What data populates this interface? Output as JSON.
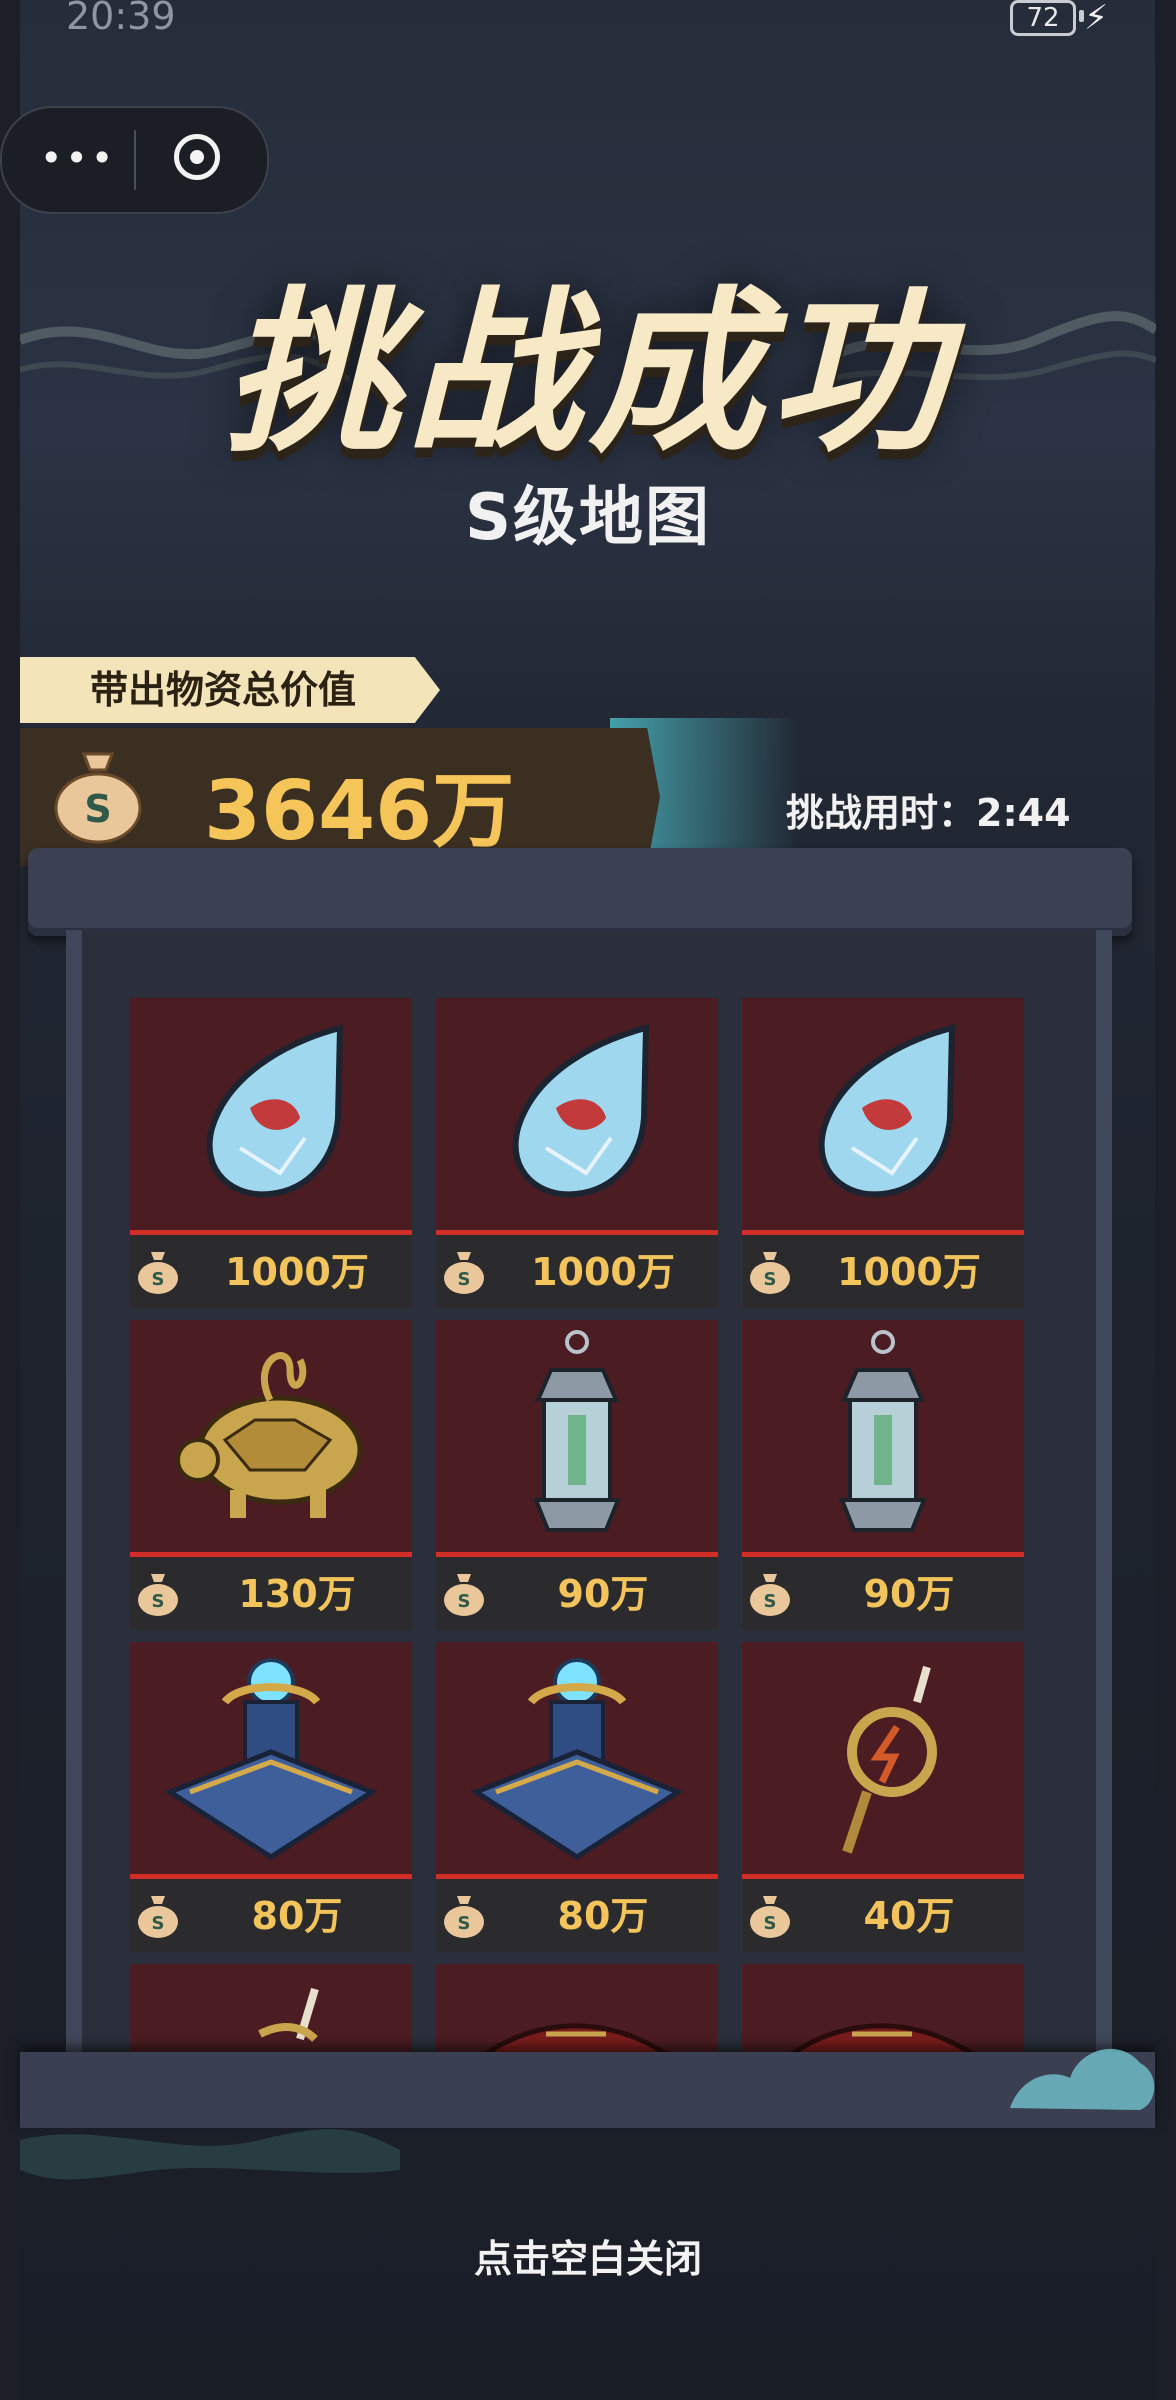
{
  "status_bar": {
    "time": "20:39",
    "battery": "72"
  },
  "capsule": {
    "more_icon": "more-dots-icon",
    "close_icon": "target-circle-icon"
  },
  "header": {
    "title": "挑战成功",
    "subtitle": "S级地图"
  },
  "summary": {
    "total_label": "带出物资总价值",
    "total_value": "3646万",
    "time_text": "挑战用时：2:44"
  },
  "items": [
    {
      "icon": "crystal-shard-icon",
      "price": "1000万"
    },
    {
      "icon": "crystal-shard-icon",
      "price": "1000万"
    },
    {
      "icon": "crystal-shard-icon",
      "price": "1000万"
    },
    {
      "icon": "golden-turtle-icon",
      "price": "130万"
    },
    {
      "icon": "lantern-icon",
      "price": "90万"
    },
    {
      "icon": "lantern-icon",
      "price": "90万"
    },
    {
      "icon": "crystal-altar-icon",
      "price": "80万"
    },
    {
      "icon": "crystal-altar-icon",
      "price": "80万"
    },
    {
      "icon": "lightning-scepter-icon",
      "price": "40万"
    },
    {
      "icon": "scepter-icon",
      "price": ""
    },
    {
      "icon": "red-relic-icon",
      "price": ""
    },
    {
      "icon": "red-relic-icon",
      "price": ""
    }
  ],
  "footer": {
    "close_hint": "点击空白关闭"
  },
  "colors": {
    "gold": "#f2c45b",
    "card_bg": "#4b1c22",
    "accent_red": "#d12e28",
    "title_cream": "#f7e8c6"
  }
}
